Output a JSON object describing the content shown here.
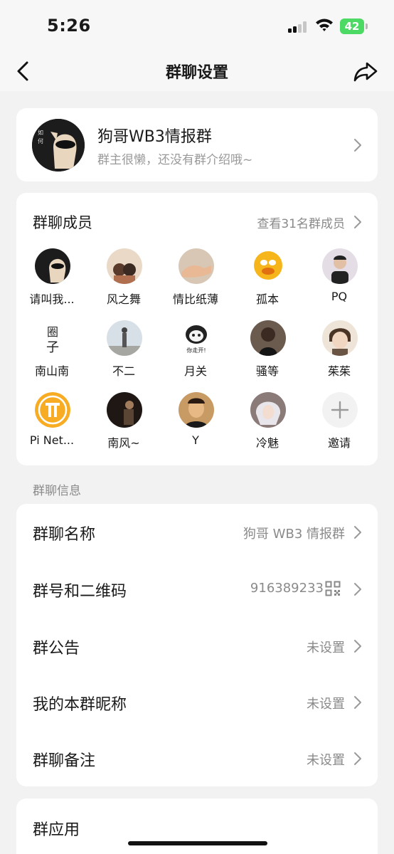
{
  "status_bar": {
    "time": "5:26",
    "battery": "42"
  },
  "nav": {
    "title": "群聊设置"
  },
  "group": {
    "name": "狗哥WB3情报群",
    "description": "群主很懒，还没有群介绍哦~"
  },
  "members": {
    "title": "群聊成员",
    "view_all": "查看31名群成员",
    "items": [
      {
        "name": "请叫我..."
      },
      {
        "name": "风之舞"
      },
      {
        "name": "情比纸薄"
      },
      {
        "name": "孤本"
      },
      {
        "name": "PQ"
      },
      {
        "name": "南山南"
      },
      {
        "name": "不二"
      },
      {
        "name": "月关"
      },
      {
        "name": "骚等"
      },
      {
        "name": "茱茱"
      },
      {
        "name": "Pi Net..."
      },
      {
        "name": "南风~"
      },
      {
        "name": "Y"
      },
      {
        "name": "冷魅"
      },
      {
        "name": "邀请"
      }
    ]
  },
  "info_section": {
    "label": "群聊信息",
    "rows": [
      {
        "label": "群聊名称",
        "value": "狗哥 WB3 情报群"
      },
      {
        "label": "群号和二维码",
        "value": "916389233"
      },
      {
        "label": "群公告",
        "value": "未设置"
      },
      {
        "label": "我的本群昵称",
        "value": "未设置"
      },
      {
        "label": "群聊备注",
        "value": "未设置"
      }
    ]
  },
  "apps_section": {
    "title": "群应用"
  },
  "colors": {
    "accent_green": "#4cd964",
    "secondary_text": "#8a8a8a",
    "background": "#f2f2f2",
    "card": "#ffffff"
  }
}
